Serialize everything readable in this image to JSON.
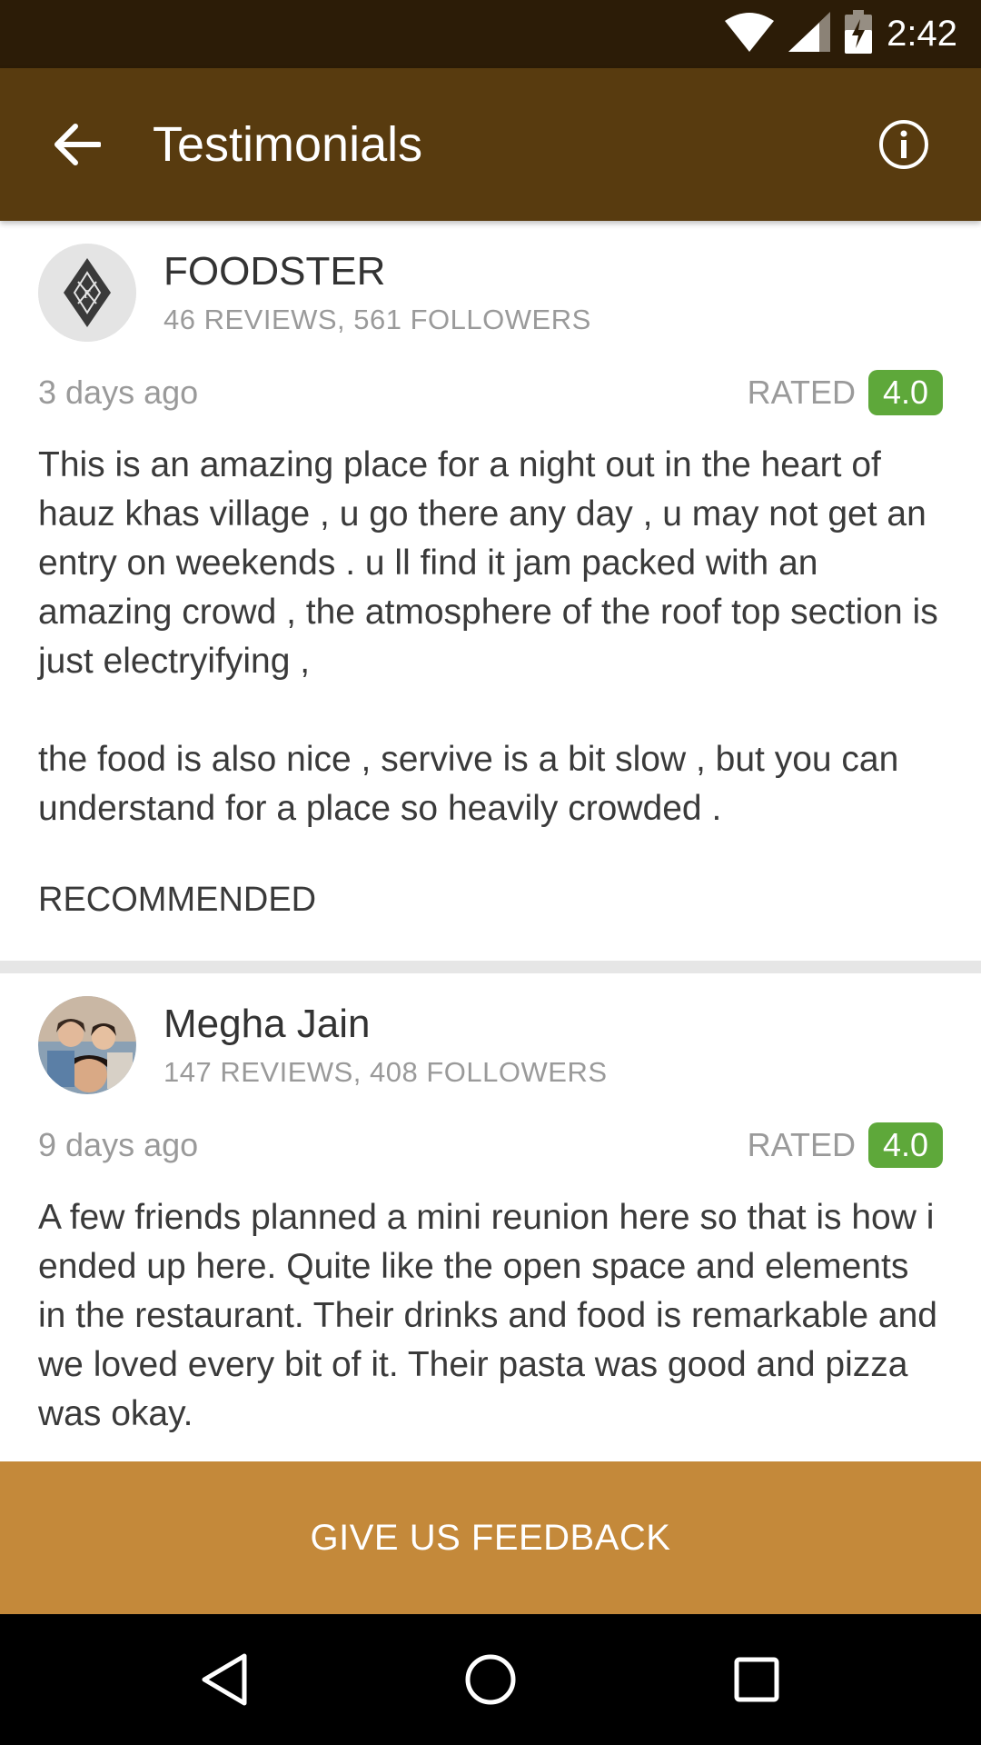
{
  "status_bar": {
    "time": "2:42",
    "icons": [
      "wifi-icon",
      "signal-icon",
      "battery-charging-icon"
    ]
  },
  "app_bar": {
    "back_icon": "arrow-back-icon",
    "title": "Testimonials",
    "info_icon": "info-icon"
  },
  "reviews": [
    {
      "name": "FOODSTER",
      "stats": "46 REVIEWS, 561 FOLLOWERS",
      "ago": "3 days ago",
      "rated_label": "RATED",
      "rating": "4.0",
      "text": "This is an amazing place for a night out in the heart of hauz khas village , u go there any day , u may not get an entry on weekends . u ll find it jam packed with an amazing crowd , the atmosphere of the roof top section is just electryifying ,\n\nthe food is also nice , servive is a bit slow , but you can understand for a place so heavily crowded .",
      "recommended": "RECOMMENDED"
    },
    {
      "name": "Megha Jain",
      "stats": "147 REVIEWS, 408 FOLLOWERS",
      "ago": "9 days ago",
      "rated_label": "RATED",
      "rating": "4.0",
      "text": "A few friends planned a mini reunion here so that is how i ended up here. Quite like the open space and elements in the restaurant. Their drinks and food is remarkable and we loved every bit of it. Their pasta was good and pizza was okay."
    }
  ],
  "feedback_button": "GIVE US FEEDBACK",
  "nav": {
    "back": "nav-back-icon",
    "home": "nav-home-icon",
    "recents": "nav-recents-icon"
  },
  "colors": {
    "status_bar": "#2c1c07",
    "app_bar": "#583b0f",
    "rating_badge": "#5ea83a",
    "feedback_bar": "#c4893a"
  }
}
